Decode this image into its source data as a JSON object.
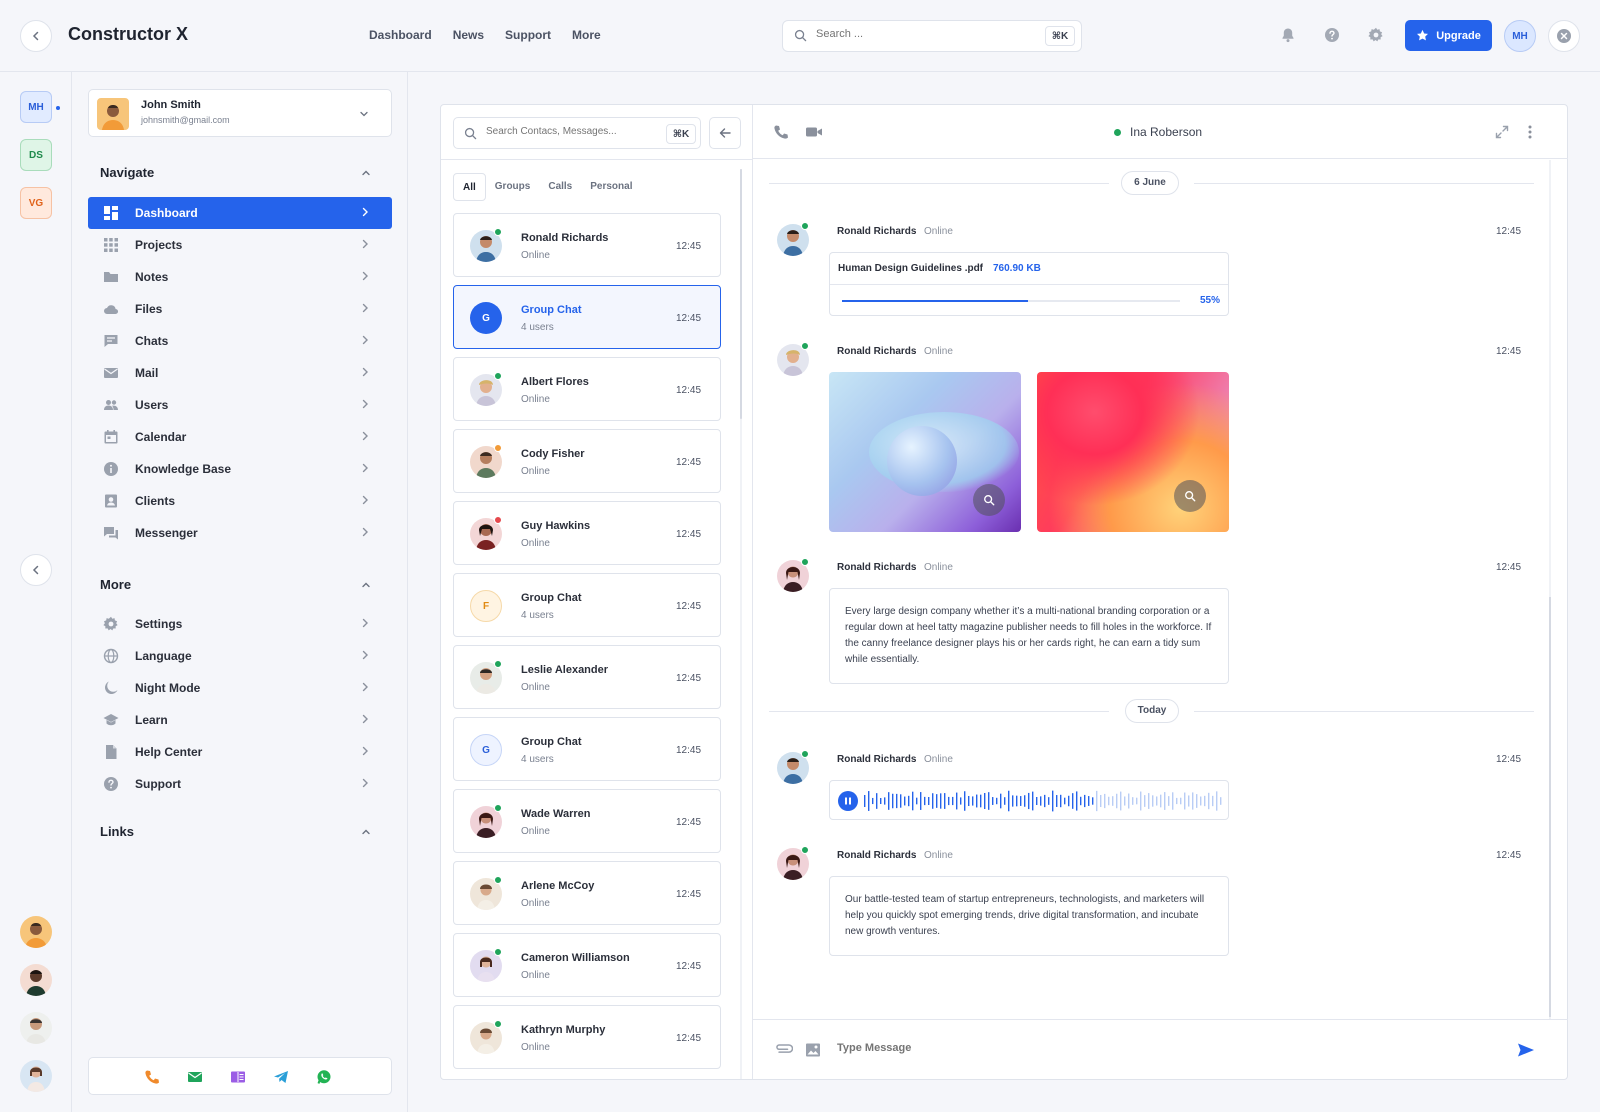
{
  "header": {
    "brand": "Constructor X",
    "nav": [
      "Dashboard",
      "News",
      "Support",
      "More"
    ],
    "search_placeholder": "Search ...",
    "search_shortcut": "⌘K",
    "upgrade_label": "Upgrade",
    "user_initials": "MH",
    "accent": "#2563eb"
  },
  "rail": {
    "workspaces": [
      {
        "initials": "MH",
        "bg": "#e1ebff",
        "fg": "#2b5fd9"
      },
      {
        "initials": "DS",
        "bg": "#dff5e7",
        "fg": "#1f8a4c"
      },
      {
        "initials": "VG",
        "bg": "#ffe9dd",
        "fg": "#e0621a"
      }
    ]
  },
  "sidebar": {
    "user": {
      "name": "John Smith",
      "email": "johnsmith@gmail.com"
    },
    "navigate_title": "Navigate",
    "navigate_items": [
      {
        "label": "Dashboard",
        "icon": "dashboard-icon"
      },
      {
        "label": "Projects",
        "icon": "grid-icon"
      },
      {
        "label": "Notes",
        "icon": "folder-icon"
      },
      {
        "label": "Files",
        "icon": "cloud-icon"
      },
      {
        "label": "Chats",
        "icon": "chat-icon"
      },
      {
        "label": "Mail",
        "icon": "mail-icon"
      },
      {
        "label": "Users",
        "icon": "users-icon"
      },
      {
        "label": "Calendar",
        "icon": "calendar-icon"
      },
      {
        "label": "Knowledge Base",
        "icon": "info-icon"
      },
      {
        "label": "Clients",
        "icon": "contact-card-icon"
      },
      {
        "label": "Messenger",
        "icon": "messenger-icon"
      }
    ],
    "more_title": "More",
    "more_items": [
      {
        "label": "Settings",
        "icon": "gear-icon"
      },
      {
        "label": "Language",
        "icon": "globe-icon"
      },
      {
        "label": "Night Mode",
        "icon": "moon-icon"
      },
      {
        "label": "Learn",
        "icon": "graduation-cap-icon"
      },
      {
        "label": "Help Center",
        "icon": "document-icon"
      },
      {
        "label": "Support",
        "icon": "help-icon"
      }
    ],
    "links_title": "Links"
  },
  "contacts": {
    "search_placeholder": "Search Contacs, Messages...",
    "search_shortcut": "⌘K",
    "tabs": [
      "All",
      "Groups",
      "Calls",
      "Personal"
    ],
    "items": [
      {
        "name": "Ronald Richards",
        "status": "Online",
        "time": "12:45",
        "dot": "#1fa45b"
      },
      {
        "name": "Group Chat",
        "status": "4 users",
        "time": "12:45",
        "initial": "G",
        "selected": true
      },
      {
        "name": "Albert Flores",
        "status": "Online",
        "time": "12:45",
        "dot": "#1fa45b"
      },
      {
        "name": "Cody Fisher",
        "status": "Online",
        "time": "12:45",
        "dot": "#f29b38"
      },
      {
        "name": "Guy Hawkins",
        "status": "Online",
        "time": "12:45",
        "dot": "#e5484d"
      },
      {
        "name": "Group Chat",
        "status": "4 users",
        "time": "12:45",
        "initial": "F"
      },
      {
        "name": "Leslie Alexander",
        "status": "Online",
        "time": "12:45",
        "dot": "#1fa45b"
      },
      {
        "name": "Group Chat",
        "status": "4 users",
        "time": "12:45",
        "initial": "G"
      },
      {
        "name": "Wade Warren",
        "status": "Online",
        "time": "12:45",
        "dot": "#1fa45b"
      },
      {
        "name": "Arlene McCoy",
        "status": "Online",
        "time": "12:45",
        "dot": "#1fa45b"
      },
      {
        "name": "Cameron Williamson",
        "status": "Online",
        "time": "12:45",
        "dot": "#1fa45b"
      },
      {
        "name": "Kathryn Murphy",
        "status": "Online",
        "time": "12:45",
        "dot": "#1fa45b"
      }
    ]
  },
  "conversation": {
    "contact_name": "Ina Roberson",
    "date1": "6 June",
    "date2": "Today",
    "messages": [
      {
        "name": "Ronald Richards",
        "status": "Online",
        "time": "12:45"
      },
      {
        "name": "Ronald Richards",
        "status": "Online",
        "time": "12:45"
      },
      {
        "name": "Ronald Richards",
        "status": "Online",
        "time": "12:45"
      },
      {
        "name": "Ronald Richards",
        "status": "Online",
        "time": "12:45"
      },
      {
        "name": "Ronald Richards",
        "status": "Online",
        "time": "12:45"
      }
    ],
    "file": {
      "name": "Human Design Guidelines .pdf",
      "size": "760.90 KB",
      "progress_label": "55%",
      "progress": 0.55
    },
    "text1": "Every large design company whether it’s a multi-national branding corporation or a regular down at heel tatty magazine publisher needs to fill holes in the workforce. If the canny freelance designer plays his or her cards right, he can earn a tidy sum while essentially.",
    "text2": "Our battle-tested team of startup entrepreneurs, technologists, and marketers will help you quickly spot emerging trends, drive digital transformation, and incubate new growth ventures.",
    "composer_placeholder": "Type Message"
  }
}
